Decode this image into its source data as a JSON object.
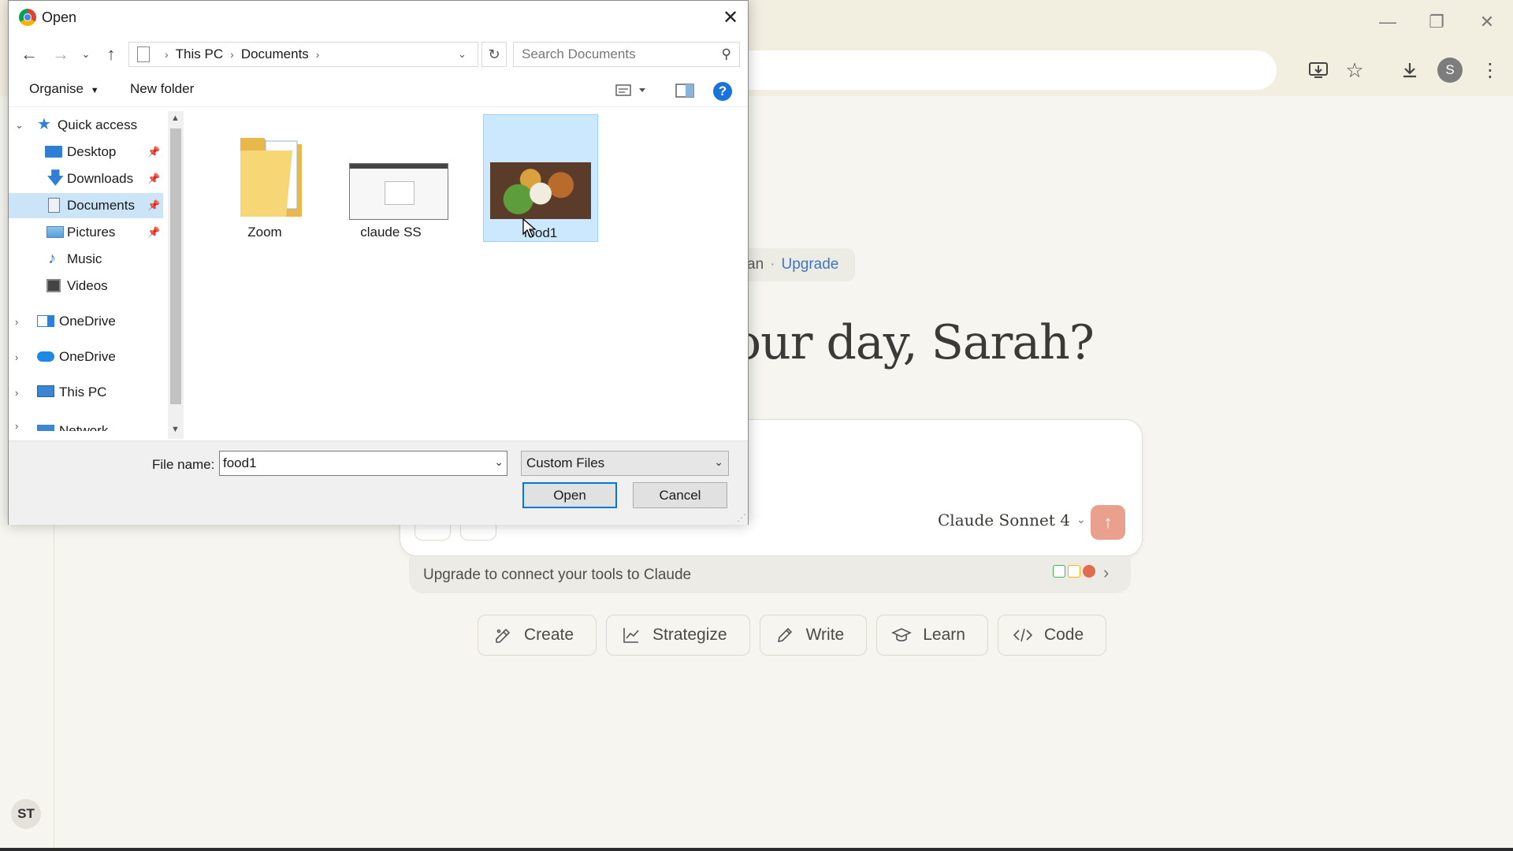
{
  "dialog": {
    "title": "Open",
    "breadcrumb": [
      "This PC",
      "Documents"
    ],
    "search_placeholder": "Search Documents",
    "toolbar": {
      "organise": "Organise",
      "new_folder": "New folder"
    },
    "tree": [
      {
        "label": "Quick access",
        "icon": "star-icon",
        "color": "#2f7fd6"
      },
      {
        "label": "Desktop",
        "icon": "desktop-icon",
        "color": "#2f7fd6",
        "pinned": true
      },
      {
        "label": "Downloads",
        "icon": "download-arrow-icon",
        "color": "#2f7fd6",
        "pinned": true
      },
      {
        "label": "Documents",
        "icon": "document-icon",
        "color": "#6d7c8d",
        "pinned": true,
        "selected": true
      },
      {
        "label": "Pictures",
        "icon": "pictures-icon",
        "color": "#5aa0d8",
        "pinned": true
      },
      {
        "label": "Music",
        "icon": "music-icon",
        "color": "#3a78c6"
      },
      {
        "label": "Videos",
        "icon": "videos-icon",
        "color": "#444"
      },
      {
        "label": "OneDrive",
        "icon": "onedrive-icon",
        "color": "#2f7fd6"
      },
      {
        "label": "OneDrive",
        "icon": "cloud-icon",
        "color": "#1e88e5"
      },
      {
        "label": "This PC",
        "icon": "computer-icon",
        "color": "#3b85d2"
      },
      {
        "label": "Network",
        "icon": "network-icon",
        "color": "#3b85d2"
      }
    ],
    "files": [
      {
        "name": "Zoom",
        "kind": "folder"
      },
      {
        "name": "claude SS",
        "kind": "image"
      },
      {
        "name": "food1",
        "kind": "image",
        "selected": true
      }
    ],
    "file_name_label": "File name:",
    "file_name_value": "food1",
    "file_type": "Custom Files",
    "open_label": "Open",
    "cancel_label": "Cancel"
  },
  "background": {
    "plan_text": "an",
    "upgrade_link": "Upgrade",
    "greeting": "our day, Sarah?",
    "model": "Claude Sonnet 4",
    "tools_banner": "Upgrade to connect your tools to Claude",
    "chips": [
      {
        "label": "Create",
        "icon": "create-icon"
      },
      {
        "label": "Strategize",
        "icon": "chart-icon"
      },
      {
        "label": "Write",
        "icon": "pen-icon"
      },
      {
        "label": "Learn",
        "icon": "graduation-cap-icon"
      },
      {
        "label": "Code",
        "icon": "code-icon"
      }
    ],
    "user_initials": "ST",
    "profile_initial": "S"
  }
}
